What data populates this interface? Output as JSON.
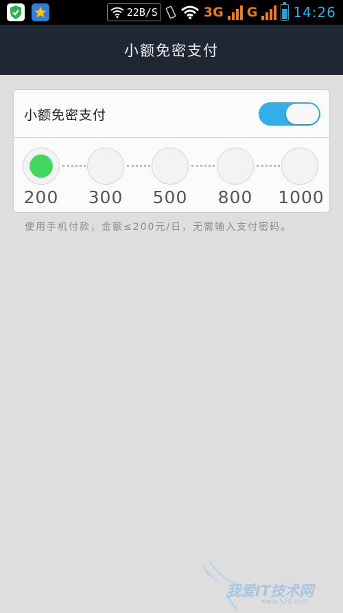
{
  "status_bar": {
    "left_icons": [
      "shield-icon",
      "star-app-icon"
    ],
    "speed": "22B/S",
    "network_1": "3G",
    "network_2": "G",
    "time": "14:26",
    "colors": {
      "network": "#f07a1e",
      "battery": "#2b9fd9",
      "clock": "#35b0e8"
    }
  },
  "header": {
    "title": "小额免密支付",
    "background": "#1f2734"
  },
  "setting": {
    "label": "小额免密支付",
    "toggle_on": true,
    "toggle_color": "#35ade6"
  },
  "amounts": {
    "options": [
      "200",
      "300",
      "500",
      "800",
      "1000"
    ],
    "selected": "200",
    "selected_color": "#42d860"
  },
  "hint": "使用手机付款，金额≤200元/日，无需输入支付密码。",
  "watermark": {
    "text": "我爱IT技术网",
    "url": "www.52ij.com"
  }
}
